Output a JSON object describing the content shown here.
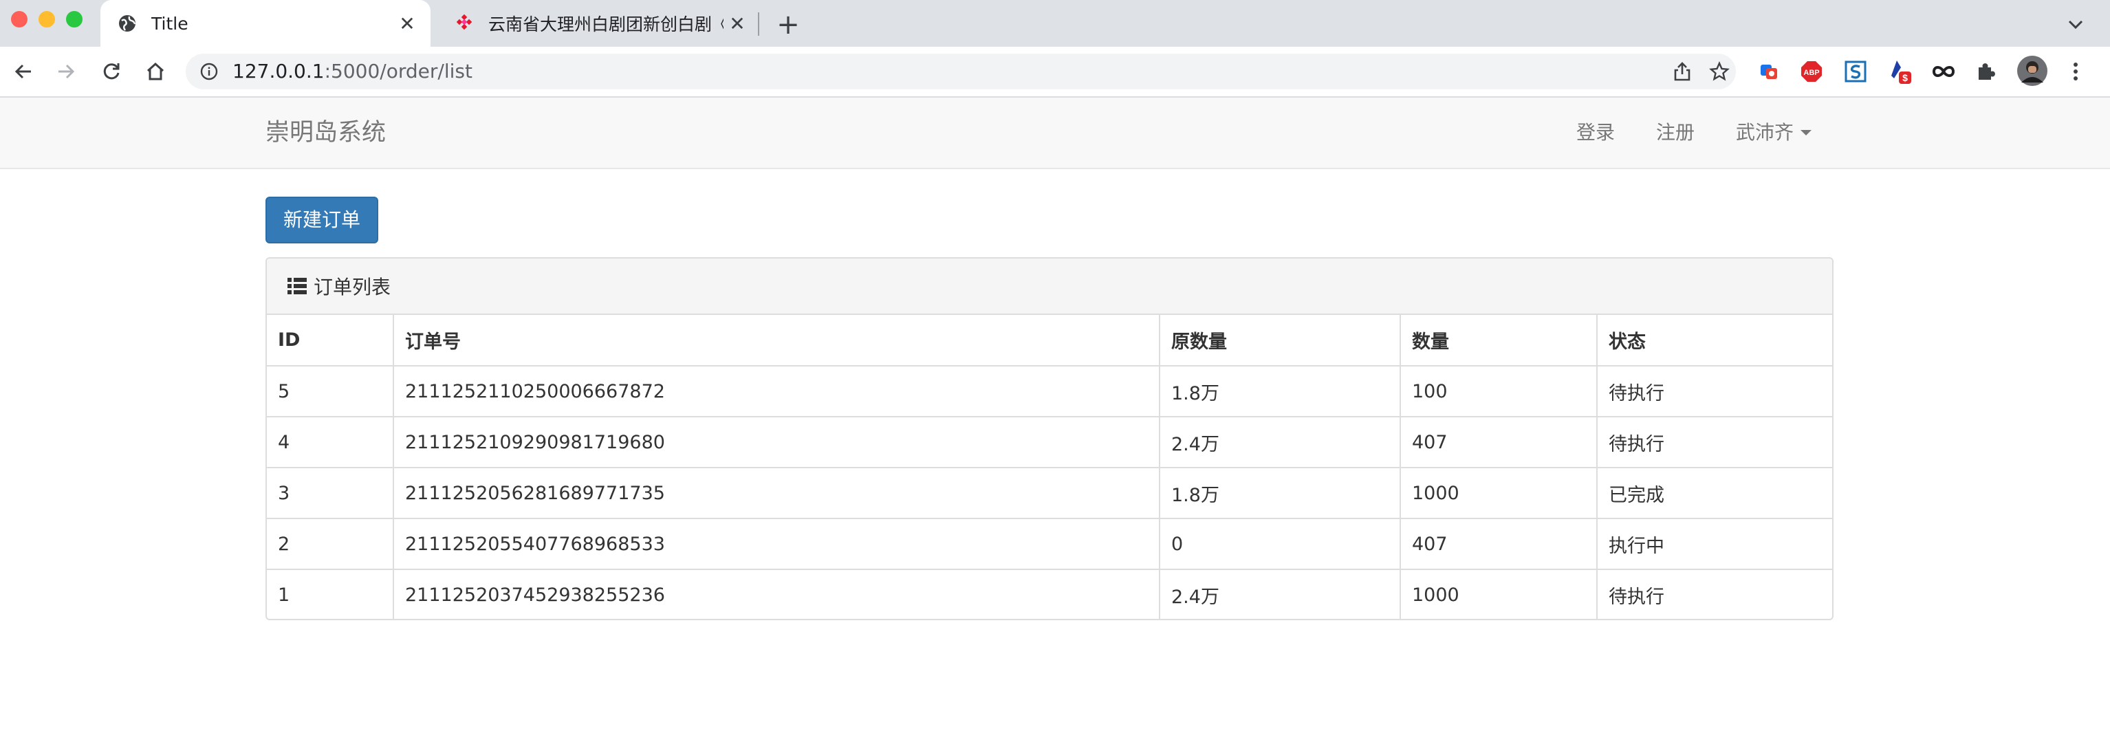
{
  "browser": {
    "tabs": [
      {
        "title": "Title",
        "icon": "globe-icon",
        "active": true
      },
      {
        "title": "云南省大理州白剧团新创白剧《",
        "icon": "weibo-grid-icon",
        "active": false
      }
    ],
    "url_host": "127.0.0.1",
    "url_path": ":5000/order/list",
    "extensions": [
      "translate-extension-icon",
      "adblock-extension-icon",
      "s-extension-icon",
      "dollar-extension-icon",
      "infinity-extension-icon",
      "puzzle-icon",
      "avatar",
      "kebab-menu-icon"
    ]
  },
  "navbar": {
    "brand": "崇明岛系统",
    "login": "登录",
    "register": "注册",
    "user": "武沛齐"
  },
  "actions": {
    "new_order": "新建订单"
  },
  "panel": {
    "title": "订单列表"
  },
  "table": {
    "headers": [
      "ID",
      "订单号",
      "原数量",
      "数量",
      "状态"
    ],
    "rows": [
      [
        "5",
        "2111252110250006667872",
        "1.8万",
        "100",
        "待执行"
      ],
      [
        "4",
        "2111252109290981719680",
        "2.4万",
        "407",
        "待执行"
      ],
      [
        "3",
        "2111252056281689771735",
        "1.8万",
        "1000",
        "已完成"
      ],
      [
        "2",
        "2111252055407768968533",
        "0",
        "407",
        "执行中"
      ],
      [
        "1",
        "2111252037452938255236",
        "2.4万",
        "1000",
        "待执行"
      ]
    ]
  },
  "colors": {
    "primary": "#337ab7",
    "navbar_bg": "#f8f8f8",
    "panel_heading_bg": "#f5f5f5"
  }
}
